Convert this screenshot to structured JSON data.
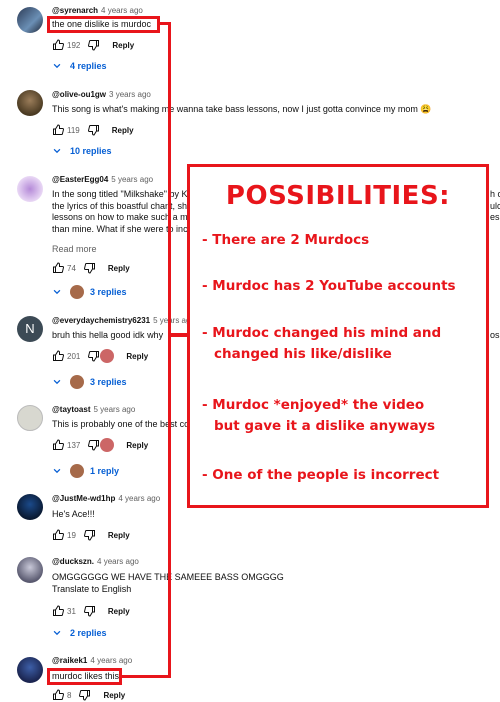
{
  "comments": [
    {
      "handle": "@syrenarch",
      "time": "4 years ago",
      "text": [
        "the one dislike is murdoc"
      ],
      "likes": "192",
      "reply_label": "Reply",
      "replies_label": "4 replies"
    },
    {
      "handle": "@olive-ou1gw",
      "time": "3 years ago",
      "text": [
        "This song is what's making me wanna take bass lessons, now I just gotta convince my mom 😩"
      ],
      "likes": "119",
      "reply_label": "Reply",
      "replies_label": "10 replies"
    },
    {
      "handle": "@EasterEgg04",
      "time": "5 years ago",
      "text": [
        "In the song titled \"Milkshake\" by K",
        "the lyrics of this boastful chant, sh",
        "lessons on how to make such a m",
        "than mine. What if she were to inc"
      ],
      "read_more": "Read more",
      "likes": "74",
      "reply_label": "Reply",
      "replies_label": "3 replies"
    },
    {
      "handle": "@everydaychemistry6231",
      "time": "5 years ago",
      "text": [
        "bruh this hella good idk why"
      ],
      "likes": "201",
      "reply_label": "Reply",
      "replies_label": "3 replies"
    },
    {
      "handle": "@taytoast",
      "time": "5 years ago",
      "text": [
        "This is probably one of the best co"
      ],
      "likes": "137",
      "reply_label": "Reply",
      "replies_label": "1 reply"
    },
    {
      "handle": "@JustMe-wd1hp",
      "time": "4 years ago",
      "text": [
        "He's Ace!!!"
      ],
      "likes": "19",
      "reply_label": "Reply"
    },
    {
      "handle": "@duckszn.",
      "time": "4 years ago",
      "text": [
        "OMGGGGGG WE HAVE THE SAMEEE BASS OMGGGG"
      ],
      "translate": "Translate to English",
      "likes": "31",
      "reply_label": "Reply",
      "replies_label": "2 replies"
    },
    {
      "handle": "@raikek1",
      "time": "4 years ago",
      "text": [
        "murdoc likes this"
      ],
      "likes": "8",
      "reply_label": "Reply"
    }
  ],
  "overlay": {
    "title": "POSSIBILITIES:",
    "items": [
      [
        "- There are 2 Murdocs"
      ],
      [
        "- Murdoc has 2 YouTube accounts"
      ],
      [
        "- Murdoc changed his mind and",
        "  changed his like/dislike"
      ],
      [
        "- Murdoc *enjoyed* the video",
        "  but gave it a dislike anyways"
      ],
      [
        "- One of the people is incorrect"
      ]
    ],
    "color": "#e8151b"
  },
  "partial_right_text": {
    "c1": "h c",
    "c2": "ulc",
    "c3": "esp",
    "c4": "os"
  },
  "colors": {
    "link": "#065fd4",
    "meta": "#606060",
    "accent": "#e8151b"
  }
}
